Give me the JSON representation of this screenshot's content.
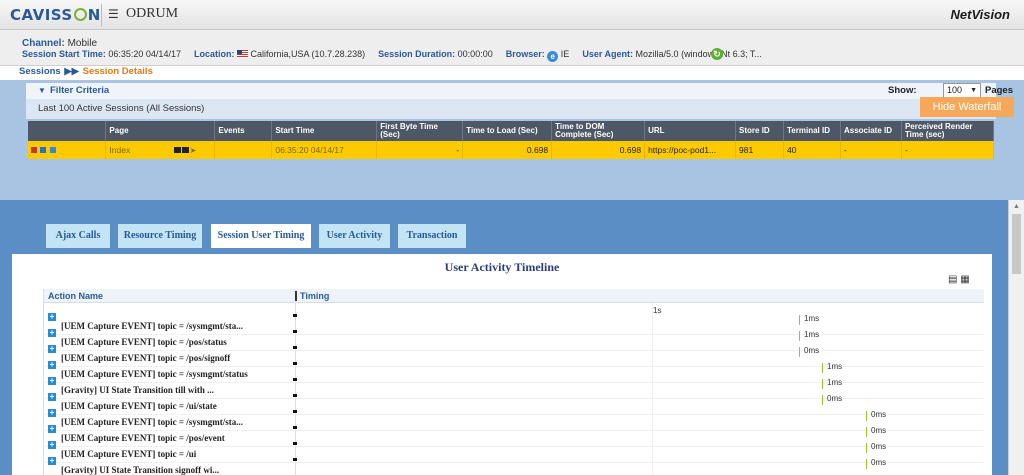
{
  "header": {
    "brand": "CAVISSON",
    "product": "ODRUM",
    "right_title": "NetVision"
  },
  "session_info": {
    "channel_label": "Channel:",
    "channel_value": "Mobile",
    "start_label": "Session Start Time:",
    "start_value": "06:35:20 04/14/17",
    "location_label": "Location:",
    "location_value": "California,USA (10.7.28.238)",
    "duration_label": "Session Duration:",
    "duration_value": "00:00:00",
    "browser_label": "Browser:",
    "browser_value": "IE",
    "agent_label": "User Agent:",
    "agent_value": "Mozilla/5.0 (windows Nt 6.3; T..."
  },
  "breadcrumb": {
    "root": "Sessions",
    "current": "Session Details"
  },
  "filter": {
    "label": "Filter Criteria",
    "show_label": "Show:",
    "show_value": "100",
    "pages_label": "Pages"
  },
  "subtitle": "Last 100 Active Sessions (All Sessions)",
  "sessions_table": {
    "columns": [
      "",
      "Page",
      "Events",
      "Start Time",
      "First Byte Time (Sec)",
      "Time to Load (Sec)",
      "Time to DOM Complete (Sec)",
      "URL",
      "Store ID",
      "Terminal ID",
      "Associate ID",
      "Perceived Render Time (sec)"
    ],
    "row": {
      "page": "Index",
      "events": "",
      "start_time": "06:35:20 04/14/17",
      "first_byte": "-",
      "load": "0.698",
      "dom": "0.698",
      "url": "https://poc-pod1...",
      "store": "981",
      "terminal": "40",
      "associate": "-",
      "render": "-"
    }
  },
  "hide_waterfall": "Hide Waterfall",
  "tabs": [
    "Ajax Calls",
    "Resource Timing",
    "Session User Timing",
    "User Activity",
    "Transaction"
  ],
  "timeline": {
    "title": "User Activity Timeline",
    "col_action": "Action Name",
    "col_timing": "Timing",
    "scale_label": "1s",
    "rows": [
      {
        "name": "[UEM Capture EVENT] topic = /sysmgmt/sta...",
        "value": "1ms"
      },
      {
        "name": "[UEM Capture EVENT] topic = /pos/status",
        "value": "1ms"
      },
      {
        "name": "[UEM Capture EVENT] topic = /pos/signoff",
        "value": "0ms"
      },
      {
        "name": "[UEM Capture EVENT] topic = /sysmgmt/status",
        "value": "1ms"
      },
      {
        "name": "[Gravity] UI State Transition till with ...",
        "value": "1ms"
      },
      {
        "name": "[UEM Capture EVENT] topic = /ui/state",
        "value": "0ms"
      },
      {
        "name": "[UEM Capture EVENT] topic = /sysmgmt/sta...",
        "value": "0ms"
      },
      {
        "name": "[UEM Capture EVENT] topic = /pos/event",
        "value": "0ms"
      },
      {
        "name": "[UEM Capture EVENT] topic = /ui",
        "value": "0ms"
      },
      {
        "name": "[Gravity] UI State Transition signoff wi...",
        "value": "0ms"
      }
    ]
  },
  "colors": {
    "brand_blue": "#2a5a96",
    "accent_orange": "#e07a1a",
    "highlight_row": "#fcca00",
    "tab_bg": "#c2e4f5",
    "waterfall_bg": "#5a8ec5"
  }
}
